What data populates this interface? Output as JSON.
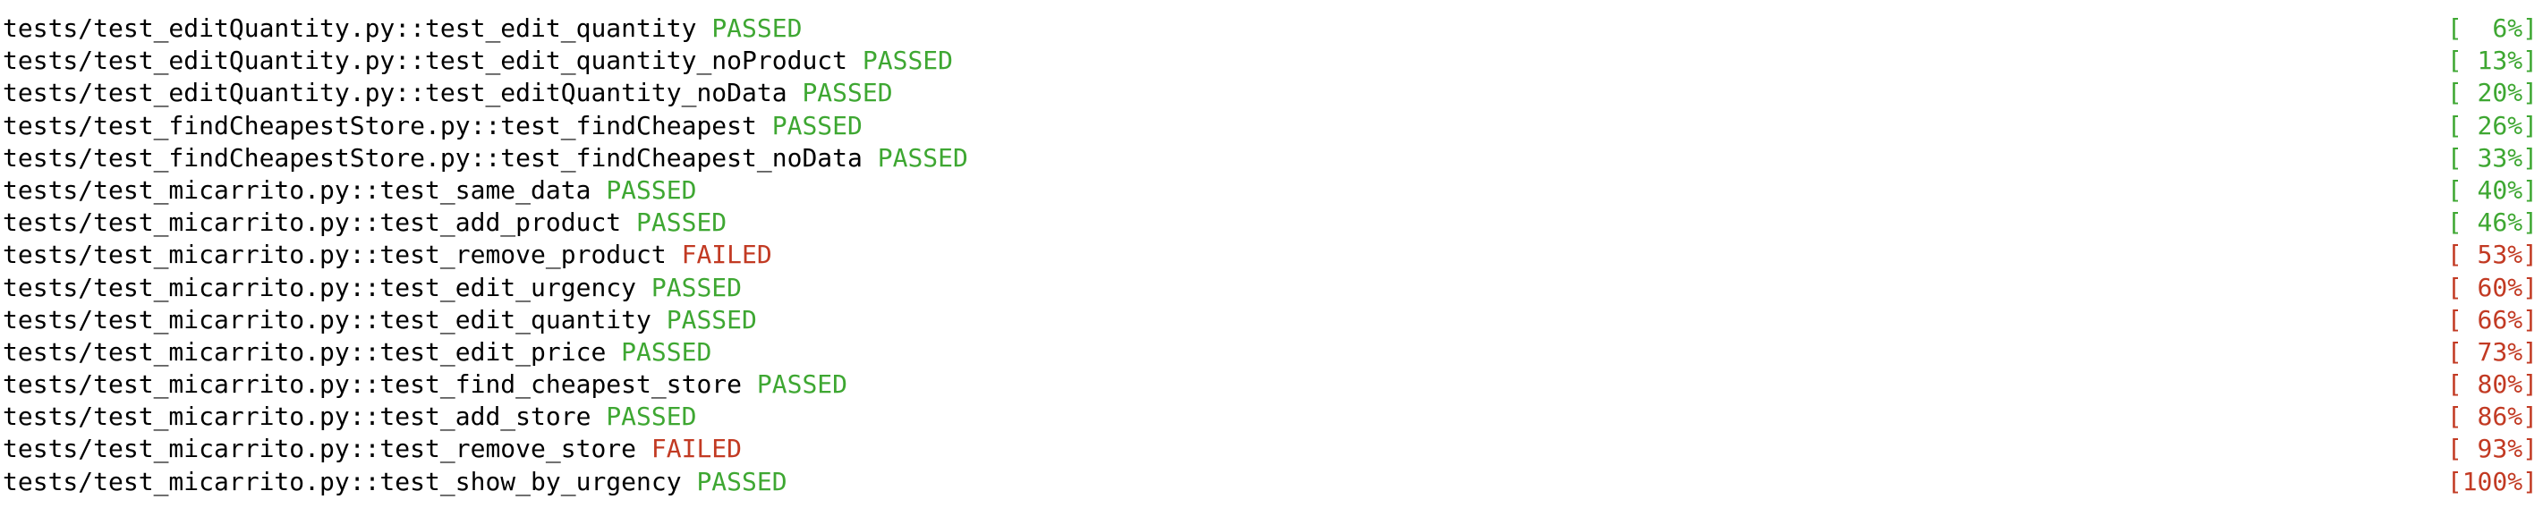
{
  "colors": {
    "passed": "#3ea732",
    "failed": "#c23a23",
    "text": "#000000",
    "background": "#ffffff"
  },
  "results": [
    {
      "test": "tests/test_editQuantity.py::test_edit_quantity",
      "status": "PASSED",
      "progress": "[  6%]",
      "progress_color": "green"
    },
    {
      "test": "tests/test_editQuantity.py::test_edit_quantity_noProduct",
      "status": "PASSED",
      "progress": "[ 13%]",
      "progress_color": "green"
    },
    {
      "test": "tests/test_editQuantity.py::test_editQuantity_noData",
      "status": "PASSED",
      "progress": "[ 20%]",
      "progress_color": "green"
    },
    {
      "test": "tests/test_findCheapestStore.py::test_findCheapest",
      "status": "PASSED",
      "progress": "[ 26%]",
      "progress_color": "green"
    },
    {
      "test": "tests/test_findCheapestStore.py::test_findCheapest_noData",
      "status": "PASSED",
      "progress": "[ 33%]",
      "progress_color": "green"
    },
    {
      "test": "tests/test_micarrito.py::test_same_data",
      "status": "PASSED",
      "progress": "[ 40%]",
      "progress_color": "green"
    },
    {
      "test": "tests/test_micarrito.py::test_add_product",
      "status": "PASSED",
      "progress": "[ 46%]",
      "progress_color": "green"
    },
    {
      "test": "tests/test_micarrito.py::test_remove_product",
      "status": "FAILED",
      "progress": "[ 53%]",
      "progress_color": "red"
    },
    {
      "test": "tests/test_micarrito.py::test_edit_urgency",
      "status": "PASSED",
      "progress": "[ 60%]",
      "progress_color": "red"
    },
    {
      "test": "tests/test_micarrito.py::test_edit_quantity",
      "status": "PASSED",
      "progress": "[ 66%]",
      "progress_color": "red"
    },
    {
      "test": "tests/test_micarrito.py::test_edit_price",
      "status": "PASSED",
      "progress": "[ 73%]",
      "progress_color": "red"
    },
    {
      "test": "tests/test_micarrito.py::test_find_cheapest_store",
      "status": "PASSED",
      "progress": "[ 80%]",
      "progress_color": "red"
    },
    {
      "test": "tests/test_micarrito.py::test_add_store",
      "status": "PASSED",
      "progress": "[ 86%]",
      "progress_color": "red"
    },
    {
      "test": "tests/test_micarrito.py::test_remove_store",
      "status": "FAILED",
      "progress": "[ 93%]",
      "progress_color": "red"
    },
    {
      "test": "tests/test_micarrito.py::test_show_by_urgency",
      "status": "PASSED",
      "progress": "[100%]",
      "progress_color": "red"
    }
  ]
}
